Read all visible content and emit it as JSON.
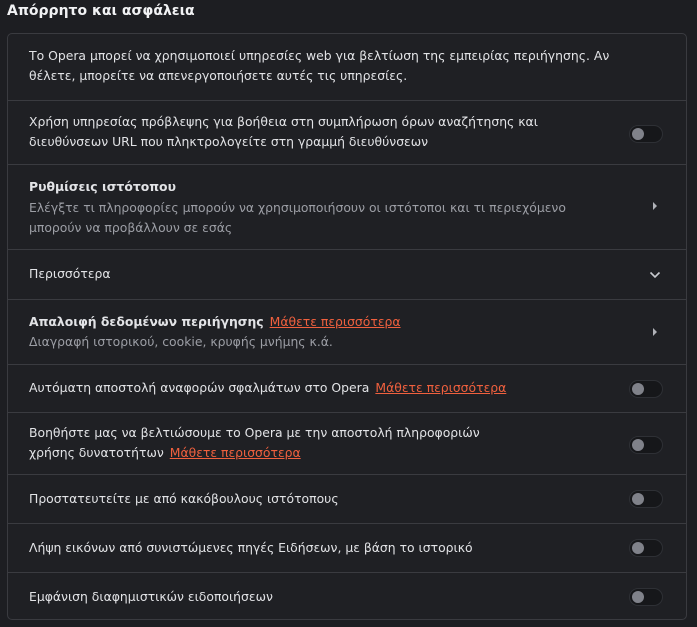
{
  "section": {
    "title": "Απόρρητο και ασφάλεια"
  },
  "rows": {
    "intro": {
      "text": "Το Opera μπορεί να χρησιμοποιεί υπηρεσίες web για βελτίωση της εμπειρίας περιήγησης. Αν θέλετε, μπορείτε να απενεργοποιήσετε αυτές τις υπηρεσίες."
    },
    "prediction": {
      "text": "Χρήση υπηρεσίας πρόβλεψης για βοήθεια στη συμπλήρωση όρων αναζήτησης και διευθύνσεων URL που πληκτρολογείτε στη γραμμή διευθύνσεων",
      "enabled": false
    },
    "site_settings": {
      "title": "Ρυθμίσεις ιστότοπου",
      "subtitle": "Ελέγξτε τι πληροφορίες μπορούν να χρησιμοποιήσουν οι ιστότοποι και τι περιεχόμενο μπορούν να προβάλλουν σε εσάς"
    },
    "more": {
      "label": "Περισσότερα"
    },
    "clear_data": {
      "title": "Απαλοιφή δεδομένων περιήγησης",
      "link": "Μάθετε περισσότερα",
      "subtitle": "Διαγραφή ιστορικού, cookie, κρυφής μνήμης κ.ά."
    },
    "crash_reports": {
      "text": "Αυτόματη αποστολή αναφορών σφαλμάτων στο Opera",
      "link": "Μάθετε περισσότερα",
      "enabled": false
    },
    "usage_stats": {
      "text": "Βοηθήστε μας να βελτιώσουμε το Opera με την αποστολή πληροφοριών χρήσης δυνατοτήτων",
      "link": "Μάθετε περισσότερα",
      "enabled": false
    },
    "malicious_protection": {
      "text": "Προστατευτείτε με από κακόβουλους ιστότοπους",
      "enabled": false
    },
    "news_images": {
      "text": "Λήψη εικόνων από συνιστώμενες πηγές Ειδήσεων, με βάση το ιστορικό",
      "enabled": false
    },
    "promo_notifications": {
      "text": "Εμφάνιση διαφημιστικών ειδοποιήσεων",
      "enabled": false
    }
  },
  "colors": {
    "background": "#1d1e22",
    "border": "#3a3b40",
    "link": "#f0603e",
    "toggle_off": "#16171a",
    "knob": "#80828a"
  }
}
